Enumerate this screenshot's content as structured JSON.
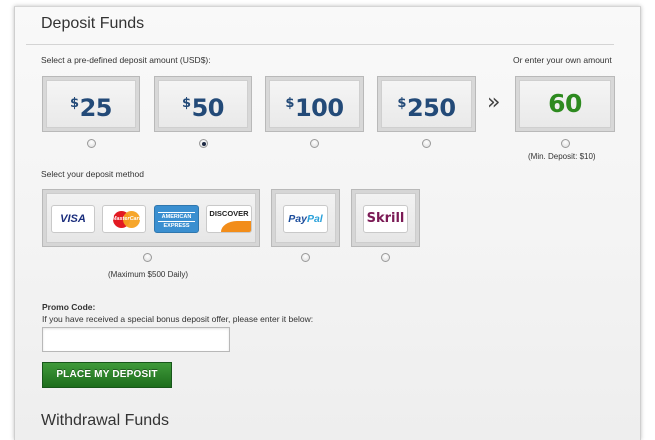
{
  "deposit": {
    "title": "Deposit Funds",
    "predefined_label": "Select a pre-defined deposit amount (USD$):",
    "own_label": "Or enter your own amount",
    "amounts": [
      {
        "currency": "$",
        "value": "25",
        "selected": false
      },
      {
        "currency": "$",
        "value": "50",
        "selected": true
      },
      {
        "currency": "$",
        "value": "100",
        "selected": false
      },
      {
        "currency": "$",
        "value": "250",
        "selected": false
      }
    ],
    "arrow": "»",
    "own_amount": "60",
    "min_note": "(Min. Deposit: $10)"
  },
  "methods": {
    "label": "Select your deposit method",
    "cards": {
      "visa": "VISA",
      "mastercard": "MasterCard",
      "amex_top": "AMERICAN",
      "amex_bottom": "EXPRESS",
      "discover": "DISCOVER"
    },
    "cards_note": "(Maximum $500 Daily)",
    "paypal_a": "Pay",
    "paypal_b": "Pal",
    "skrill": "Skrill"
  },
  "promo": {
    "label": "Promo Code:",
    "description": "If you have received a special bonus deposit offer, please enter it below:",
    "value": "",
    "placeholder": ""
  },
  "submit_label": "PLACE MY DEPOSIT",
  "withdrawal_title": "Withdrawal Funds",
  "colors": {
    "amount_text": "#234a78",
    "own_amount_text": "#2d8a1f",
    "button_green": "#2a7f27"
  }
}
